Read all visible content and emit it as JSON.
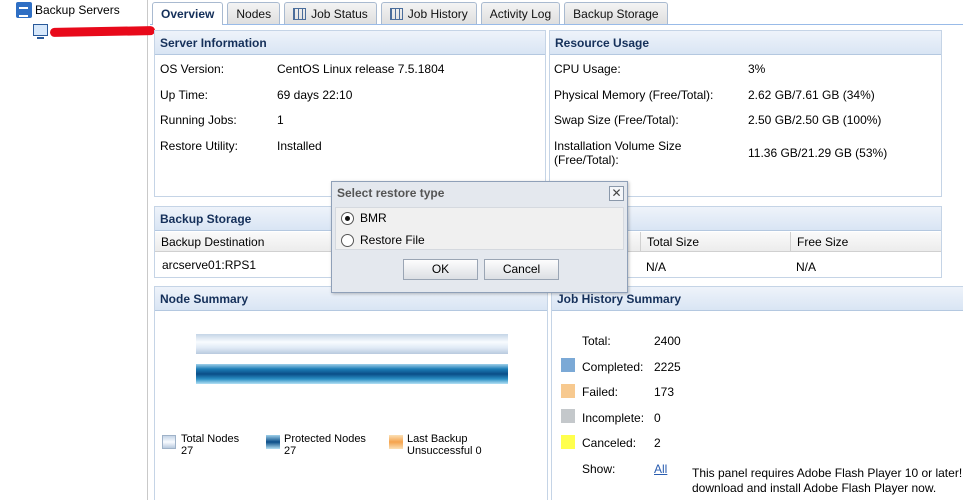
{
  "sidebar": {
    "root_label": "Backup Servers"
  },
  "tabs": [
    {
      "label": "Overview",
      "icon": ""
    },
    {
      "label": "Nodes",
      "icon": ""
    },
    {
      "label": "Job Status",
      "icon": "job-status-icon"
    },
    {
      "label": "Job History",
      "icon": "job-history-icon"
    },
    {
      "label": "Activity Log",
      "icon": ""
    },
    {
      "label": "Backup Storage",
      "icon": ""
    }
  ],
  "server_info": {
    "title": "Server Information",
    "rows": [
      {
        "label": "OS Version:",
        "value": "CentOS Linux release 7.5.1804"
      },
      {
        "label": "Up Time:",
        "value": "69 days 22:10"
      },
      {
        "label": "Running Jobs:",
        "value": "1"
      },
      {
        "label": "Restore Utility:",
        "value": "Installed"
      }
    ]
  },
  "resource_usage": {
    "title": "Resource Usage",
    "rows": [
      {
        "label": "CPU Usage:",
        "value": "3%"
      },
      {
        "label": "Physical Memory (Free/Total):",
        "value": "2.62 GB/7.61 GB (34%)"
      },
      {
        "label": "Swap Size (Free/Total):",
        "value": "2.50 GB/2.50 GB (100%)"
      },
      {
        "label": "Installation Volume Size\n(Free/Total):",
        "value": "11.36 GB/21.29 GB (53%)"
      }
    ]
  },
  "backup_storage": {
    "title": "Backup Storage",
    "columns": [
      "Backup Destination",
      "Total Size",
      "Free Size"
    ],
    "rows": [
      {
        "destination": "arcserve01:RPS1",
        "total": "N/A",
        "free": "N/A"
      }
    ]
  },
  "node_summary": {
    "title": "Node Summary",
    "legend": [
      {
        "label": "Total Nodes",
        "value": "27"
      },
      {
        "label": "Protected Nodes",
        "value": "27"
      },
      {
        "label": "Last Backup",
        "value": "Unsuccessful 0"
      }
    ]
  },
  "job_history_summary": {
    "title": "Job History Summary",
    "total_label": "Total:",
    "total_value": "2400",
    "items": [
      {
        "label": "Completed:",
        "value": "2225",
        "color": "#7ba9d6"
      },
      {
        "label": "Failed:",
        "value": "173",
        "color": "#f7c98f"
      },
      {
        "label": "Incomplete:",
        "value": "0",
        "color": "#c4c8cb"
      },
      {
        "label": "Canceled:",
        "value": "2",
        "color": "#ffff4d"
      }
    ],
    "show_label": "Show:",
    "show_link": "All",
    "flash_note_line1": "This panel requires Adobe Flash Player 10 or later!",
    "flash_note_line2": "download and install Adobe Flash Player now."
  },
  "dialog": {
    "title": "Select restore type",
    "options": [
      {
        "label": "BMR",
        "selected": true
      },
      {
        "label": "Restore File",
        "selected": false
      }
    ],
    "ok_label": "OK",
    "cancel_label": "Cancel"
  },
  "colors": {
    "header_text": "#15305a",
    "tab_border": "#a9bad0",
    "link": "#2a5db0"
  }
}
